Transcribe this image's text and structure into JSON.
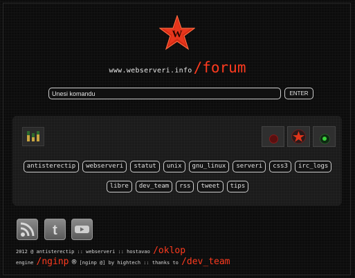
{
  "header": {
    "domain": "www.webserveri.info",
    "section": "/forum"
  },
  "command": {
    "placeholder": "Unesi komandu",
    "value": "",
    "enter_label": "ENTER"
  },
  "tags_row1": [
    "antisterectip",
    "webserveri",
    "statut",
    "unix",
    "gnu_linux",
    "serveri",
    "css3",
    "irc_logs"
  ],
  "tags_row2": [
    "libre",
    "dev_team",
    "rss",
    "tweet",
    "tips"
  ],
  "footer": {
    "line1_text": "2012 @ antisterectip :: webserveri :: hostavao",
    "line1_link": "/oklop",
    "line2_prefix": "engine",
    "line2_engine": "/nginp",
    "line2_reg": "®",
    "line2_text": "[nginp @] by hightech :: thanks to",
    "line2_link": "/dev_team"
  },
  "icons": {
    "logo": "red-star-w-logo",
    "rss": "rss-icon",
    "twitter": "twitter-icon",
    "youtube": "youtube-icon"
  },
  "colors": {
    "accent": "#ff3b1f",
    "background": "#0c0c0c",
    "panel": "#1b1b1b"
  }
}
